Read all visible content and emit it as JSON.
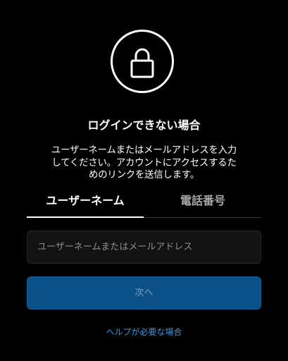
{
  "header": {
    "icon": "lock-icon",
    "title": "ログインできない場合",
    "description": "ユーザーネームまたはメールアドレスを入力\nしてください。アカウントにアクセスするた\nめのリンクを送信します。"
  },
  "tabs": [
    {
      "label": "ユーザーネーム",
      "active": true
    },
    {
      "label": "電話番号",
      "active": false
    }
  ],
  "form": {
    "input_value": "",
    "input_placeholder": "ユーザーネームまたはメールアドレス",
    "next_label": "次へ"
  },
  "footer": {
    "help_label": "ヘルプが必要な場合"
  },
  "colors": {
    "background": "#000000",
    "primary_button": "#0c5289",
    "link": "#3d97e6",
    "inactive_tab": "#a8a8a8"
  }
}
